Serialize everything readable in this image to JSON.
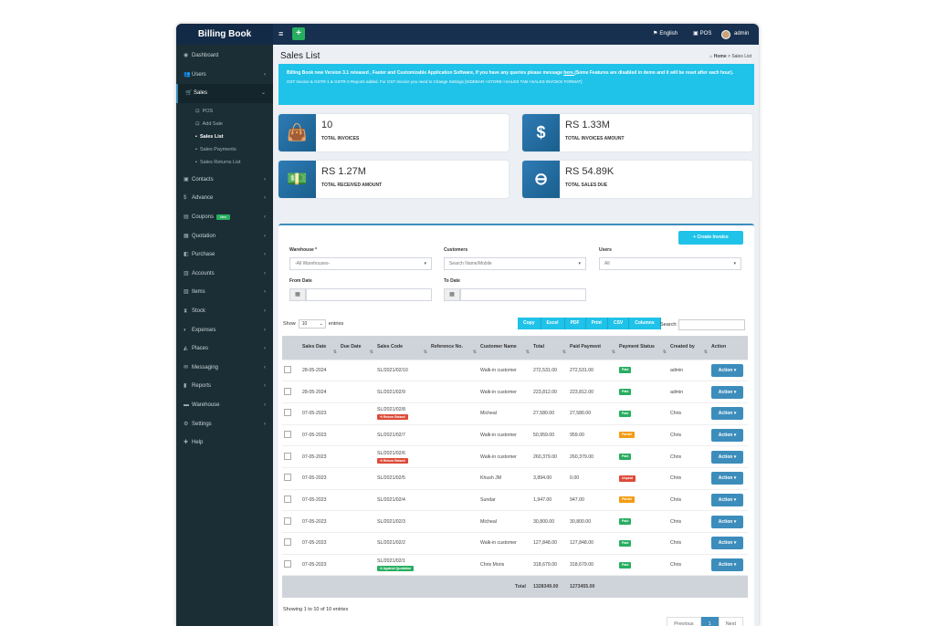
{
  "app": {
    "brand": "Billing Book",
    "add_icon": "+",
    "menu_icon": "≡"
  },
  "topbar": {
    "language": "English",
    "pos": "POS",
    "user": "admin"
  },
  "sidebar": {
    "items": [
      {
        "label": "Dashboard",
        "icon": "dashboard-icon",
        "glyph": "◉",
        "chev": ""
      },
      {
        "label": "Users",
        "icon": "users-icon",
        "glyph": "👥",
        "chev": "‹"
      },
      {
        "label": "Sales",
        "icon": "sales-icon",
        "glyph": "🛒",
        "chev": "⌄",
        "active": true
      }
    ],
    "sales_sub": [
      "POS",
      "Add Sale",
      "Sales List",
      "Sales Payments",
      "Sales Returns List"
    ],
    "items2": [
      {
        "label": "Contacts",
        "glyph": "▣"
      },
      {
        "label": "Advance",
        "glyph": "$"
      },
      {
        "label": "Coupons",
        "glyph": "▤",
        "badge": "New"
      },
      {
        "label": "Quotation",
        "glyph": "▦"
      },
      {
        "label": "Purchase",
        "glyph": "◧"
      },
      {
        "label": "Accounts",
        "glyph": "▥"
      },
      {
        "label": "Items",
        "glyph": "▨"
      },
      {
        "label": "Stock",
        "glyph": "⧗"
      },
      {
        "label": "Expenses",
        "glyph": "◐"
      },
      {
        "label": "Places",
        "glyph": "◭"
      },
      {
        "label": "Messaging",
        "glyph": "✉"
      },
      {
        "label": "Reports",
        "glyph": "▮"
      },
      {
        "label": "Warehouse",
        "glyph": "▬"
      },
      {
        "label": "Settings",
        "glyph": "⚙"
      },
      {
        "label": "Help",
        "glyph": "✚"
      }
    ]
  },
  "page": {
    "title": "Sales List",
    "breadcrumb_home": "Home",
    "breadcrumb_sep": ">",
    "breadcrumb_current": "Sales List"
  },
  "alert": {
    "line1": "Billing Book new Version 3.1 released , Faster and Customizable Application Software, If you have any queries please message",
    "link": "here.",
    "line1b": "(Some Features are disabled in demo and it will be reset after each hour).",
    "line3": "GST Invoice & GSTR-1 & GSTR-3 Reports added. For GST Invoice you need to Change Settings [SIDEBAR->STORE->SALES TAB->SALES INVOICE FORMAT]"
  },
  "stats": [
    {
      "value": "10",
      "label": "TOTAL INVOICES",
      "icon": "shopping-bag-icon",
      "glyph": "👜"
    },
    {
      "value": "RS 1.33M",
      "label": "TOTAL INVOICES AMOUNT",
      "icon": "dollar-icon",
      "glyph": "$"
    },
    {
      "value": "RS 1.27M",
      "label": "TOTAL RECEIVED AMOUNT",
      "icon": "money-icon",
      "glyph": "💵"
    },
    {
      "value": "RS 54.89K",
      "label": "TOTAL SALES DUE",
      "icon": "minus-circle-icon",
      "glyph": "⊖"
    }
  ],
  "filters": {
    "create_button": "+ Create Invoice",
    "warehouse_label": "Warehouse *",
    "warehouse_value": "-All Warehouses-",
    "customers_label": "Customers",
    "customers_placeholder": "Search Name/Mobile",
    "users_label": "Users",
    "users_value": "All",
    "from_label": "From Date",
    "to_label": "To Date"
  },
  "table_controls": {
    "show": "Show",
    "entries_value": "10",
    "entries": "entries",
    "export_buttons": [
      "Copy",
      "Excel",
      "PDF",
      "Print",
      "CSV",
      "Columns"
    ],
    "search": "Search:"
  },
  "table": {
    "headers": [
      "Sales Date",
      "Due Date",
      "Sales Code",
      "Reference No.",
      "Customer Name",
      "Total",
      "Paid Payment",
      "Payment Status",
      "Created by",
      "Action"
    ],
    "rows": [
      {
        "date": "28-05-2024",
        "due": "",
        "code": "SL/2021/02/10",
        "ref": "",
        "customer": "Walk-in customer",
        "total": "272,531.00",
        "paid": "272,531.00",
        "status": "Paid",
        "status_class": "st-paid",
        "by": "admin",
        "tag": "",
        "tag_class": ""
      },
      {
        "date": "28-05-2024",
        "due": "",
        "code": "SL/2021/02/9",
        "ref": "",
        "customer": "Walk-in customer",
        "total": "223,812.00",
        "paid": "223,812.00",
        "status": "Paid",
        "status_class": "st-paid",
        "by": "admin",
        "tag": "",
        "tag_class": ""
      },
      {
        "date": "07-05-2023",
        "due": "",
        "code": "SL/2021/02/8",
        "ref": "",
        "customer": "Micheal",
        "total": "27,580.00",
        "paid": "27,580.00",
        "status": "Paid",
        "status_class": "st-paid",
        "by": "Chris",
        "tag": "⟲ Return Raised",
        "tag_class": "red"
      },
      {
        "date": "07-05-2023",
        "due": "",
        "code": "SL/2021/02/7",
        "ref": "",
        "customer": "Walk-in customer",
        "total": "50,959.00",
        "paid": "959.00",
        "status": "Partial",
        "status_class": "st-partial",
        "by": "Chris",
        "tag": "",
        "tag_class": ""
      },
      {
        "date": "07-05-2023",
        "due": "",
        "code": "SL/2021/02/6",
        "ref": "",
        "customer": "Walk-in customer",
        "total": "260,379.00",
        "paid": "260,379.00",
        "status": "Paid",
        "status_class": "st-paid",
        "by": "Chris",
        "tag": "⟲ Return Raised",
        "tag_class": "red"
      },
      {
        "date": "07-05-2023",
        "due": "",
        "code": "SL/2021/02/5",
        "ref": "",
        "customer": "Khush JM",
        "total": "3,894.00",
        "paid": "0.00",
        "status": "Unpaid",
        "status_class": "st-unpaid",
        "by": "Chris",
        "tag": "",
        "tag_class": ""
      },
      {
        "date": "07-05-2023",
        "due": "",
        "code": "SL/2021/02/4",
        "ref": "",
        "customer": "Sundar",
        "total": "1,947.00",
        "paid": "947.00",
        "status": "Partial",
        "status_class": "st-partial",
        "by": "Chris",
        "tag": "",
        "tag_class": ""
      },
      {
        "date": "07-05-2023",
        "due": "",
        "code": "SL/2021/02/3",
        "ref": "",
        "customer": "Micheal",
        "total": "30,800.00",
        "paid": "30,800.00",
        "status": "Paid",
        "status_class": "st-paid",
        "by": "Chris",
        "tag": "",
        "tag_class": ""
      },
      {
        "date": "07-05-2023",
        "due": "",
        "code": "SL/2021/02/2",
        "ref": "",
        "customer": "Walk-in customer",
        "total": "127,848.00",
        "paid": "127,848.00",
        "status": "Paid",
        "status_class": "st-paid",
        "by": "Chris",
        "tag": "",
        "tag_class": ""
      },
      {
        "date": "07-05-2023",
        "due": "",
        "code": "SL/2021/02/1",
        "ref": "",
        "customer": "Chris Moris",
        "total": "318,679.00",
        "paid": "318,679.00",
        "status": "Paid",
        "status_class": "st-paid",
        "by": "Chris",
        "tag": "⊙ Against Quotation",
        "tag_class": "green"
      }
    ],
    "action_label": "Action ▾",
    "total_label": "Total",
    "total_sum": "1328349.00",
    "paid_sum": "1273455.00"
  },
  "footer": {
    "showing": "Showing 1 to 10 of 10 entries",
    "previous": "Previous",
    "page": "1",
    "next": "Next"
  }
}
